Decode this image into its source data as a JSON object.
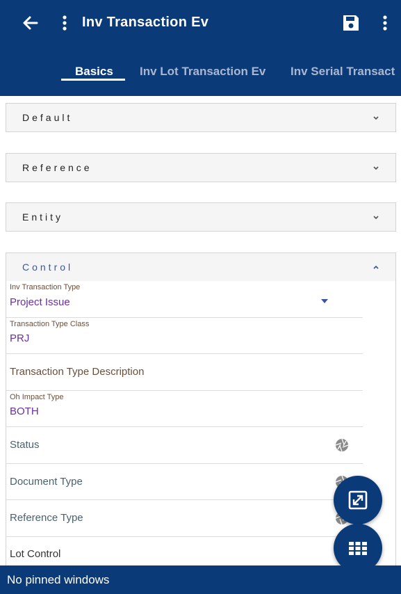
{
  "header": {
    "title": "Inv Transaction Ev"
  },
  "tabs": [
    {
      "label": "Basics",
      "active": true
    },
    {
      "label": "Inv Lot Transaction Ev",
      "active": false
    },
    {
      "label": "Inv Serial Transact",
      "active": false
    }
  ],
  "sections": [
    {
      "label": "Default",
      "expanded": false
    },
    {
      "label": "Reference",
      "expanded": false
    },
    {
      "label": "Entity",
      "expanded": false
    },
    {
      "label": "Control",
      "expanded": true
    }
  ],
  "control_fields": {
    "inv_transaction_type": {
      "label": "Inv Transaction Type",
      "value": "Project Issue"
    },
    "transaction_type_class": {
      "label": "Transaction Type Class",
      "value": "PRJ"
    },
    "transaction_type_description": {
      "placeholder": "Transaction Type Description"
    },
    "oh_impact_type": {
      "label": "Oh Impact Type",
      "value": "BOTH"
    },
    "status": {
      "label": "Status"
    },
    "document_type": {
      "label": "Document Type"
    },
    "reference_type": {
      "label": "Reference Type"
    },
    "lot_control": {
      "label": "Lot Control"
    }
  },
  "footer": {
    "text": "No pinned windows"
  },
  "colors": {
    "primary": "#0b3a78",
    "value_text": "#6a2fa0",
    "section_open_label": "#3a55a0"
  },
  "icons": [
    "back-arrow-icon",
    "more-vert-icon",
    "save-icon",
    "chevron-down-icon",
    "chevron-up-icon",
    "dropdown-arrow-icon",
    "aperture-icon",
    "zoom-icon",
    "grid-icon"
  ]
}
